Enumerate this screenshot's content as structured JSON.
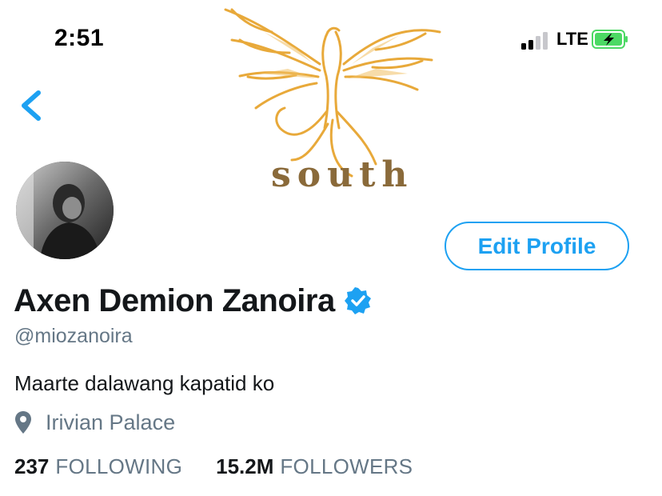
{
  "status_bar": {
    "time": "2:51",
    "network": "LTE",
    "signal_bars_active": 2,
    "signal_bars_total": 4,
    "battery_charging": true
  },
  "header": {
    "banner_text": "south",
    "back_icon": "chevron-left-icon"
  },
  "profile": {
    "display_name": "Axen Demion Zanoira",
    "verified": true,
    "handle": "@miozanoira",
    "bio": "Maarte dalawang kapatid ko",
    "location": "Irivian Palace",
    "edit_profile_label": "Edit Profile"
  },
  "stats": {
    "following_count": "237",
    "following_label": "FOLLOWING",
    "followers_count": "15.2M",
    "followers_label": "FOLLOWERS"
  },
  "colors": {
    "accent": "#1da1f2",
    "secondary_text": "#657786",
    "primary_text": "#14171a",
    "banner_gold": "#e8a93a",
    "battery_green": "#4cd964"
  }
}
